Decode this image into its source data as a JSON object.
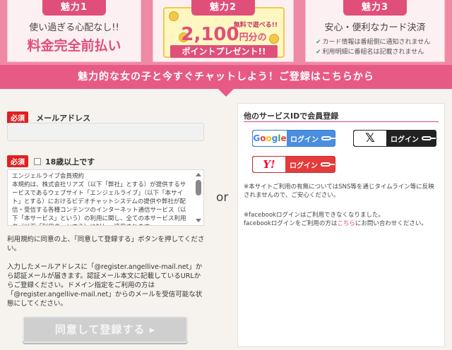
{
  "banner": {
    "card1": {
      "tag": "魅力1",
      "line1": "使い過ぎる心配なし!!",
      "line2": "料金完全前払い"
    },
    "card2": {
      "tag": "魅力2",
      "free": "無料で遊べる!!",
      "points": "2,100",
      "unit": "円分の",
      "ribbon": "ポイントプレゼント!!"
    },
    "card3": {
      "tag": "魅力3",
      "title": "安心・便利なカード決済",
      "bullets": [
        "カード情報は番組側に通知されません",
        "利用明細に番組名は記載されません"
      ]
    }
  },
  "heading": "魅力的な女の子と今すぐチャットしよう！ご登録はこちらから",
  "form": {
    "required_badge": "必須",
    "email_label": "メールアドレス",
    "email_value": "",
    "age_label": "18歳以上です",
    "terms_lines": [
      "エンジェルライブ会員規約",
      "本規約は、株式会社リアズ（以下「弊社」とする）が提供するサービスであるウェブサイト「エンジェルライブ」（以下「本サイト」とする）におけるビデオチャットシステムの提供や弊社が配信・受信する各種コンテンツのインターネット通信サービス（以下「本サービス」という）の利用に関し、全ての本サービス利用者（以下「利用者」とする）に対し、適用されます。"
    ],
    "note1": "利用規約に同意の上、「同意して登録する」ボタンを押してください。",
    "note2": "入力したメールアドレスに「@register.angellive-mail.net」から認証メールが届きます。認証メール本文に記載しているURLからご登録ください。ドメイン指定をご利用の方は「@register.angellive-mail.net」からのメールを受信可能な状態にしてください。",
    "submit_label": "同意して登録する ▸"
  },
  "separator": "or",
  "social": {
    "title": "他のサービスIDで会員登録",
    "google_logo": "Google",
    "x_logo": "𝕏",
    "yahoo_logo": "Y!",
    "login_label": "ログイン",
    "note1": "※本サイトご利用の有無についてはSNS等を通じタイムライン等に反映されませんので、ご安心ください。",
    "note2_line1": "※facebookログインはご利用できなくなりました。",
    "note2_pre": "facebookログインをご利用の方は",
    "note2_link": "こちら",
    "note2_post": "にお問い合わせください。"
  },
  "colors": {
    "accent_pink": "#e85a86",
    "tag_pink": "#e04f7a",
    "google_blue": "#4a8ee0",
    "yahoo_red": "#e53b3b"
  }
}
